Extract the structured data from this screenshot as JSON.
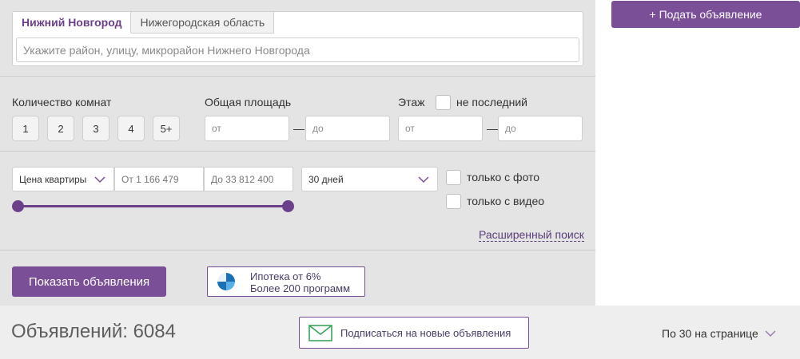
{
  "header": {
    "post_ad_label": "+ Подать объявление"
  },
  "location": {
    "tabs": [
      "Нижний Новгород",
      "Нижегородская область"
    ],
    "active_tab": "Нижний Новгород",
    "search_placeholder": "Укажите район, улицу, микрорайон Нижнего Новгорода"
  },
  "rooms": {
    "label": "Количество комнат",
    "options": [
      "1",
      "2",
      "3",
      "4",
      "5+"
    ]
  },
  "area": {
    "label": "Общая площадь",
    "from_placeholder": "от",
    "to_placeholder": "до",
    "dash": "—"
  },
  "floor": {
    "label": "Этаж",
    "not_last_label": "не последний",
    "from_placeholder": "от",
    "to_placeholder": "до",
    "dash": "—"
  },
  "price": {
    "type_select": "Цена квартиры",
    "from_placeholder": "От 1 166 479",
    "to_placeholder": "До 33 812 400",
    "slider_range": [
      0.0,
      1.0
    ]
  },
  "period": {
    "selected": "30 дней"
  },
  "media": {
    "photo_label": "только с фото",
    "video_label": "только с видео"
  },
  "advanced_search": "Расширенный поиск",
  "actions": {
    "show_label": "Показать объявления",
    "mortgage_line1": "Ипотека от 6%",
    "mortgage_line2": "Более 200 программ"
  },
  "results": {
    "count_text": "Объявлений: 6084",
    "subscribe_label": "Подписаться на новые объявления",
    "per_page_label": "По 30 на странице"
  },
  "colors": {
    "accent": "#7a4f98",
    "panel_bg": "#e4e4e4",
    "bottom_bg": "#eeeeee"
  },
  "icons": {
    "mortgage": "bank-logo-icon",
    "subscribe": "envelope-icon",
    "dropdown": "chevron-down-icon"
  }
}
